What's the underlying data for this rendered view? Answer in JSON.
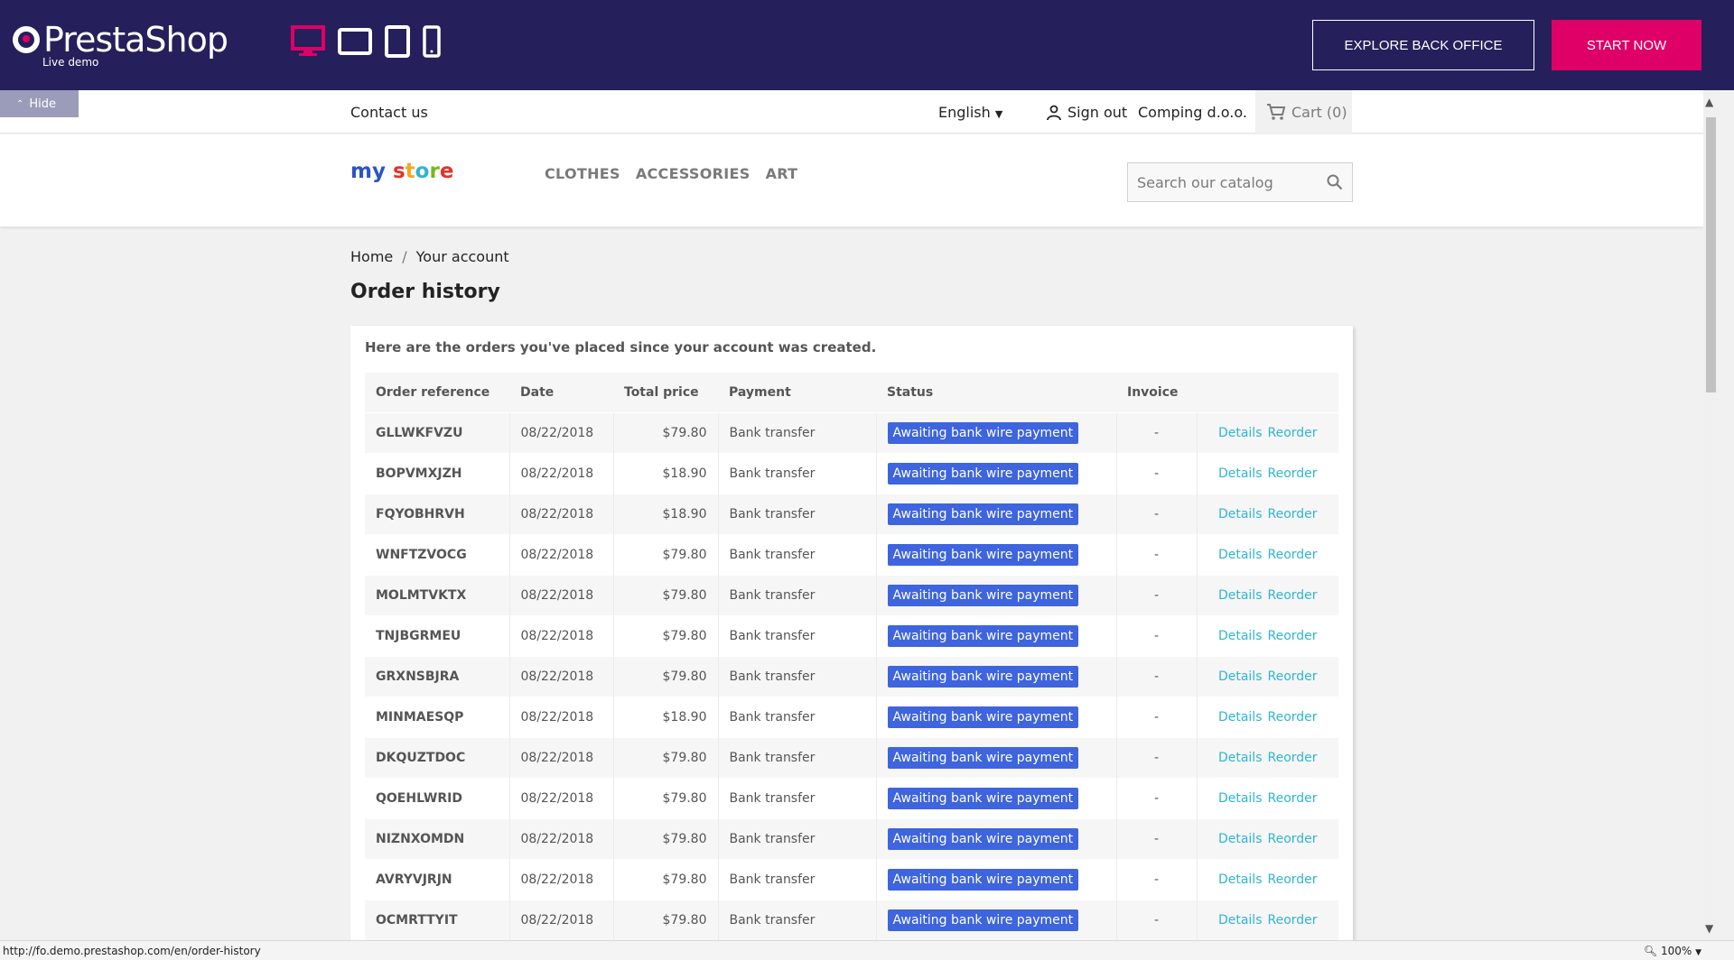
{
  "demo_bar": {
    "brand": "PrestaShop",
    "brand_sub": "Live demo",
    "explore_label": "EXPLORE BACK OFFICE",
    "start_label": "START NOW",
    "accent_color": "#df0067",
    "bg_color": "#25205b",
    "devices": [
      "desktop-icon",
      "tablet-landscape-icon",
      "tablet-portrait-icon",
      "mobile-icon"
    ]
  },
  "hide_label": "Hide",
  "nav": {
    "contact": "Contact us",
    "language": "English",
    "signout": "Sign out",
    "company": "Comping d.o.o.",
    "cart": "Cart (0)"
  },
  "header": {
    "logo": "my store",
    "menu": [
      "CLOTHES",
      "ACCESSORIES",
      "ART"
    ],
    "search_placeholder": "Search our catalog"
  },
  "breadcrumb": [
    "Home",
    "Your account"
  ],
  "page_title": "Order history",
  "intro": "Here are the orders you've placed since your account was created.",
  "table": {
    "headers": [
      "Order reference",
      "Date",
      "Total price",
      "Payment",
      "Status",
      "Invoice",
      ""
    ],
    "status_color": "#3e64de",
    "details_label": "Details",
    "reorder_label": "Reorder",
    "rows": [
      {
        "ref": "GLLWKFVZU",
        "date": "08/22/2018",
        "price": "$79.80",
        "payment": "Bank transfer",
        "status": "Awaiting bank wire payment",
        "invoice": "-"
      },
      {
        "ref": "BOPVMXJZH",
        "date": "08/22/2018",
        "price": "$18.90",
        "payment": "Bank transfer",
        "status": "Awaiting bank wire payment",
        "invoice": "-"
      },
      {
        "ref": "FQYOBHRVH",
        "date": "08/22/2018",
        "price": "$18.90",
        "payment": "Bank transfer",
        "status": "Awaiting bank wire payment",
        "invoice": "-"
      },
      {
        "ref": "WNFTZVOCG",
        "date": "08/22/2018",
        "price": "$79.80",
        "payment": "Bank transfer",
        "status": "Awaiting bank wire payment",
        "invoice": "-"
      },
      {
        "ref": "MOLMTVKTX",
        "date": "08/22/2018",
        "price": "$79.80",
        "payment": "Bank transfer",
        "status": "Awaiting bank wire payment",
        "invoice": "-"
      },
      {
        "ref": "TNJBGRMEU",
        "date": "08/22/2018",
        "price": "$79.80",
        "payment": "Bank transfer",
        "status": "Awaiting bank wire payment",
        "invoice": "-"
      },
      {
        "ref": "GRXNSBJRA",
        "date": "08/22/2018",
        "price": "$79.80",
        "payment": "Bank transfer",
        "status": "Awaiting bank wire payment",
        "invoice": "-"
      },
      {
        "ref": "MINMAESQP",
        "date": "08/22/2018",
        "price": "$18.90",
        "payment": "Bank transfer",
        "status": "Awaiting bank wire payment",
        "invoice": "-"
      },
      {
        "ref": "DKQUZTDOC",
        "date": "08/22/2018",
        "price": "$79.80",
        "payment": "Bank transfer",
        "status": "Awaiting bank wire payment",
        "invoice": "-"
      },
      {
        "ref": "QOEHLWRID",
        "date": "08/22/2018",
        "price": "$79.80",
        "payment": "Bank transfer",
        "status": "Awaiting bank wire payment",
        "invoice": "-"
      },
      {
        "ref": "NIZNXOMDN",
        "date": "08/22/2018",
        "price": "$79.80",
        "payment": "Bank transfer",
        "status": "Awaiting bank wire payment",
        "invoice": "-"
      },
      {
        "ref": "AVRYVJRJN",
        "date": "08/22/2018",
        "price": "$79.80",
        "payment": "Bank transfer",
        "status": "Awaiting bank wire payment",
        "invoice": "-"
      },
      {
        "ref": "OCMRTTYIT",
        "date": "08/22/2018",
        "price": "$79.80",
        "payment": "Bank transfer",
        "status": "Awaiting bank wire payment",
        "invoice": "-"
      }
    ]
  },
  "statusbar": {
    "url": "http://fo.demo.prestashop.com/en/order-history",
    "zoom": "100%"
  }
}
